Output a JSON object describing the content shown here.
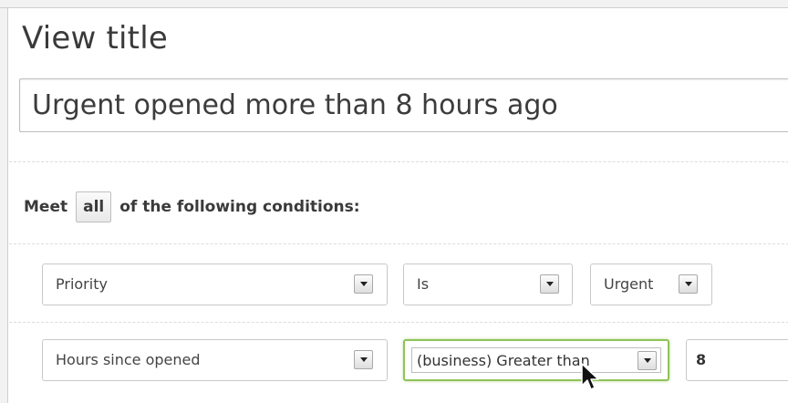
{
  "view_title": {
    "label": "View title",
    "value": "Urgent opened more than 8 hours ago"
  },
  "conditions": {
    "prefix": "Meet",
    "match": "all",
    "suffix": "of the following conditions:",
    "rows": [
      {
        "field": "Priority",
        "operator": "Is",
        "value": "Urgent"
      },
      {
        "field": "Hours since opened",
        "operator": "(business) Greater than",
        "value": "8"
      }
    ]
  },
  "colors": {
    "focus": "#8fc35a"
  },
  "icons": {
    "dropdown": "triangle-down-icon",
    "cursor": "mouse-pointer-icon"
  }
}
